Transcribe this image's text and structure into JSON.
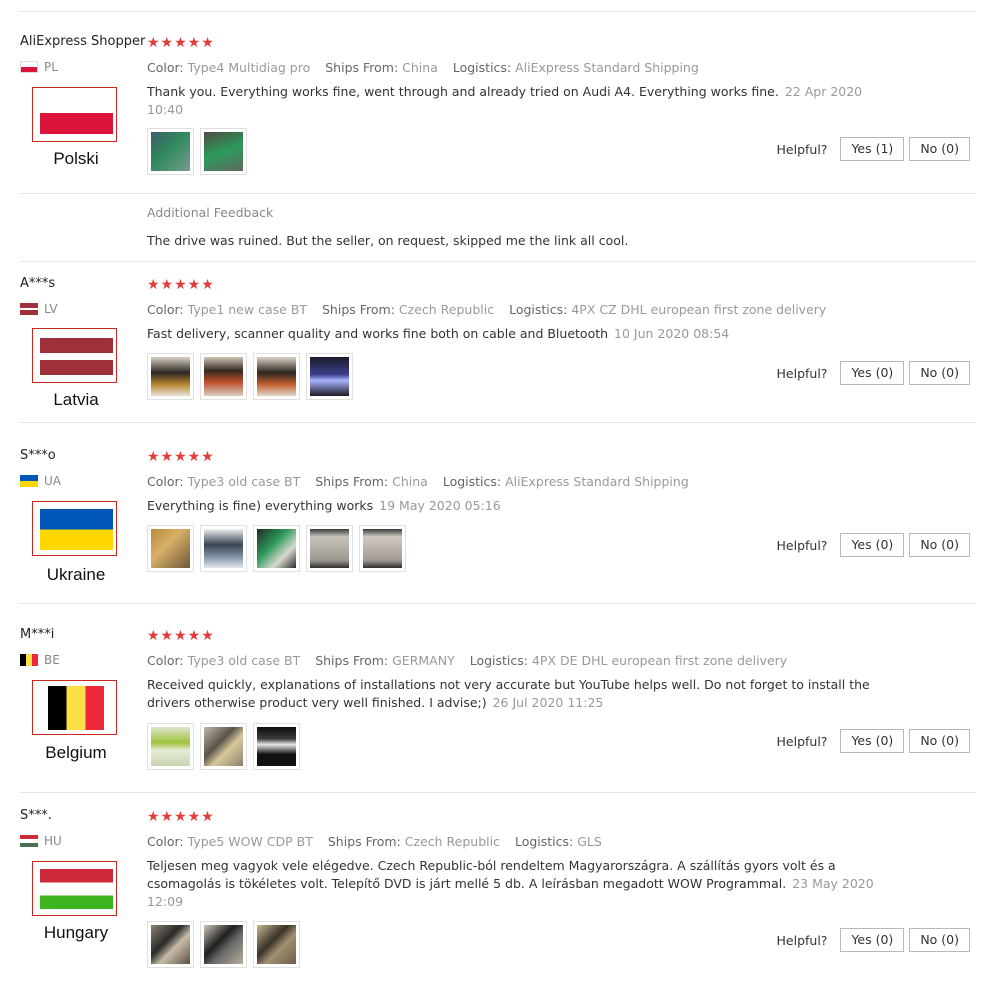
{
  "helpful_label": "Helpful?",
  "reviews": [
    {
      "user": "AliExpress Shopper",
      "country_code": "PL",
      "country_name": "Polski",
      "stars": "★★★★★",
      "color_label": "Color:",
      "color_value": "Type4 Multidiag pro",
      "ships_label": "Ships From:",
      "ships_value": "China",
      "logistics_label": "Logistics:",
      "logistics_value": "AliExpress Standard Shipping",
      "text": "Thank you. Everything works fine, went through and already tried on Audi A4. Everything works fine.",
      "date": "22 Apr 2020 10:40",
      "yes": "Yes (1)",
      "no": "No (0)",
      "additional_label": "Additional Feedback",
      "additional_text": "The drive was ruined. But the seller, on request, skipped me the link all cool."
    },
    {
      "user": "A***s",
      "country_code": "LV",
      "country_name": "Latvia",
      "stars": "★★★★★",
      "color_label": "Color:",
      "color_value": "Type1 new case BT",
      "ships_label": "Ships From:",
      "ships_value": "Czech Republic",
      "logistics_label": "Logistics:",
      "logistics_value": "4PX CZ DHL european first zone delivery",
      "text": "Fast delivery, scanner quality and works fine both on cable and Bluetooth",
      "date": "10 Jun 2020 08:54",
      "yes": "Yes (0)",
      "no": "No (0)"
    },
    {
      "user": "S***o",
      "country_code": "UA",
      "country_name": "Ukraine",
      "stars": "★★★★★",
      "color_label": "Color:",
      "color_value": "Type3 old case BT",
      "ships_label": "Ships From:",
      "ships_value": "China",
      "logistics_label": "Logistics:",
      "logistics_value": "AliExpress Standard Shipping",
      "text": "Everything is fine) everything works",
      "date": "19 May 2020 05:16",
      "yes": "Yes (0)",
      "no": "No (0)"
    },
    {
      "user": "M***i",
      "country_code": "BE",
      "country_name": "Belgium",
      "stars": "★★★★★",
      "color_label": "Color:",
      "color_value": "Type3 old case BT",
      "ships_label": "Ships From:",
      "ships_value": "GERMANY",
      "logistics_label": "Logistics:",
      "logistics_value": "4PX DE DHL european first zone delivery",
      "text": "Received quickly, explanations of installations not very accurate but YouTube helps well. Do not forget to install the drivers otherwise product very well finished. I advise;)",
      "date": "26 Jul 2020 11:25",
      "yes": "Yes (0)",
      "no": "No (0)"
    },
    {
      "user": "S***.",
      "country_code": "HU",
      "country_name": "Hungary",
      "stars": "★★★★★",
      "color_label": "Color:",
      "color_value": "Type5 WOW CDP BT",
      "ships_label": "Ships From:",
      "ships_value": "Czech Republic",
      "logistics_label": "Logistics:",
      "logistics_value": "GLS",
      "text": "Teljesen meg vagyok vele elégedve. Czech Republic-ból rendeltem Magyarországra. A szállítás gyors volt és a csomagolás is tökéletes volt. Telepítő DVD is járt mellé 5 db. A leírásban megadott WOW Programmal.",
      "date": "23 May 2020 12:09",
      "yes": "Yes (0)",
      "no": "No (0)"
    }
  ],
  "colors": {
    "star": "#e43a3a",
    "highlight_border": "#c9261e"
  },
  "flag_colors": {
    "PL": [
      "#ffffff",
      "#dc143c"
    ],
    "LV": [
      "#9e3039",
      "#ffffff",
      "#9e3039"
    ],
    "UA": [
      "#0057b7",
      "#ffd700"
    ],
    "BE": [
      "#000000",
      "#fae042",
      "#ed2939"
    ],
    "HU": [
      "#ce2939",
      "#ffffff",
      "#477050"
    ]
  }
}
